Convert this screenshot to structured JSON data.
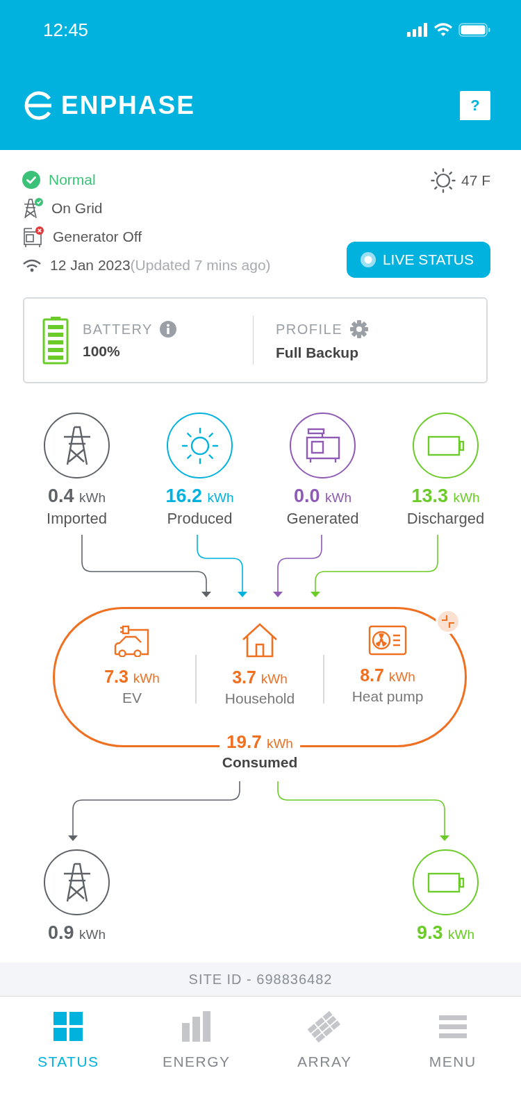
{
  "status_bar": {
    "time": "12:45"
  },
  "header": {
    "brand": "ENPHASE",
    "help": "?"
  },
  "system": {
    "items": [
      {
        "kind": "normal",
        "text": "Normal"
      },
      {
        "kind": "grid",
        "text": "On Grid",
        "ok": true
      },
      {
        "kind": "generator",
        "text": "Generator Off",
        "ok": false
      },
      {
        "kind": "connection",
        "text": "12 Jan 2023",
        "note": "(Updated 7 mins ago)"
      }
    ],
    "weather": "47 F",
    "live_button": "LIVE STATUS"
  },
  "battery_card": {
    "label": "BATTERY",
    "value": "100%",
    "level": 1,
    "profile_label": "PROFILE",
    "profile": "Full Backup"
  },
  "sources": [
    {
      "kind": "grid",
      "value": "0.4",
      "unit": "kWh",
      "label": "Imported",
      "color": "#5f6368"
    },
    {
      "kind": "solar",
      "value": "16.2",
      "unit": "kWh",
      "label": "Produced",
      "color": "#00b2dd"
    },
    {
      "kind": "generator",
      "value": "0.0",
      "unit": "kWh",
      "label": "Generated",
      "color": "#8e5ab5"
    },
    {
      "kind": "battery",
      "value": "13.3",
      "unit": "kWh",
      "label": "Discharged",
      "color": "#6bcb28"
    }
  ],
  "consumption": {
    "loads": [
      {
        "kind": "ev",
        "value": "7.3",
        "unit": "kWh",
        "label": "EV"
      },
      {
        "kind": "household",
        "value": "3.7",
        "unit": "kWh",
        "label": "Household"
      },
      {
        "kind": "heat_pump",
        "value": "8.7",
        "unit": "kWh",
        "label": "Heat pump"
      }
    ],
    "total_value": "19.7",
    "total_unit": "kWh",
    "total_label": "Consumed"
  },
  "outputs": [
    {
      "kind": "grid",
      "value": "0.9",
      "unit": "kWh",
      "color": "#5f6368"
    },
    {
      "kind": "battery",
      "value": "9.3",
      "unit": "kWh",
      "color": "#6bcb28"
    }
  ],
  "site_id": "SITE ID - 698836482",
  "tabs": [
    {
      "kind": "status",
      "label": "STATUS",
      "selected": true
    },
    {
      "kind": "energy",
      "label": "ENERGY",
      "selected": false
    },
    {
      "kind": "array",
      "label": "ARRAY",
      "selected": false
    },
    {
      "kind": "menu",
      "label": "MENU",
      "selected": false
    }
  ]
}
